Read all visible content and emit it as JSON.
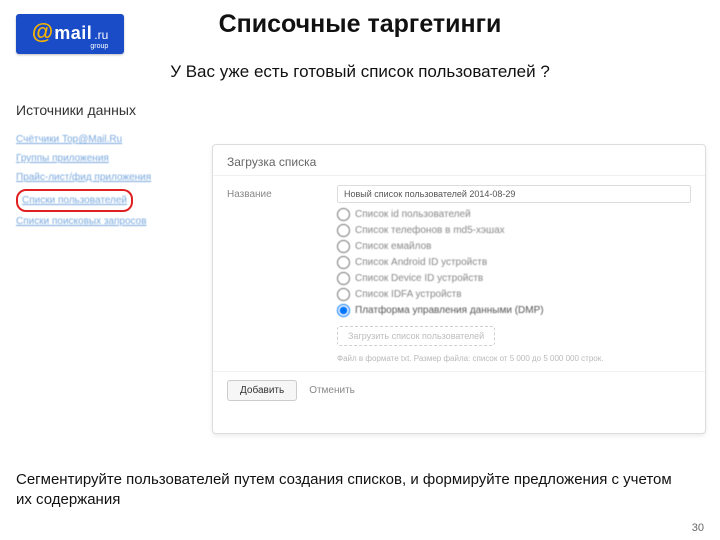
{
  "logo": {
    "at": "@",
    "name": "mail",
    "ru": ".ru",
    "group": "group"
  },
  "title": "Списочные таргетинги",
  "subtitle": "У Вас уже есть готовый список пользователей ?",
  "sectionHeading": "Источники данных",
  "sidebar": {
    "items": [
      "Счётчики Top@Mail.Ru",
      "Группы приложения",
      "Прайс-лист/фид приложения",
      "Списки пользователей",
      "Списки поисковых запросов"
    ],
    "highlightIndex": 3
  },
  "panel": {
    "header": "Загрузка списка",
    "nameLabel": "Название",
    "nameValue": "Новый список пользователей 2014-08-29",
    "options": [
      "Список id пользователей",
      "Список телефонов в md5-хэшах",
      "Список емайлов",
      "Список Android ID устройств",
      "Список Device ID устройств",
      "Список IDFA устройств",
      "Платформа управления данными (DMP)"
    ],
    "selectedIndex": 6,
    "uploadLabel": "Загрузить список пользователей",
    "hint": "Файл в формате txt. Размер файла: список от 5 000 до 5 000 000 строк.",
    "addLabel": "Добавить",
    "cancelLabel": "Отменить"
  },
  "footerText": "Сегментируйте пользователей путем создания списков,  и формируйте предложения с учетом их содержания",
  "pageNum": "30"
}
